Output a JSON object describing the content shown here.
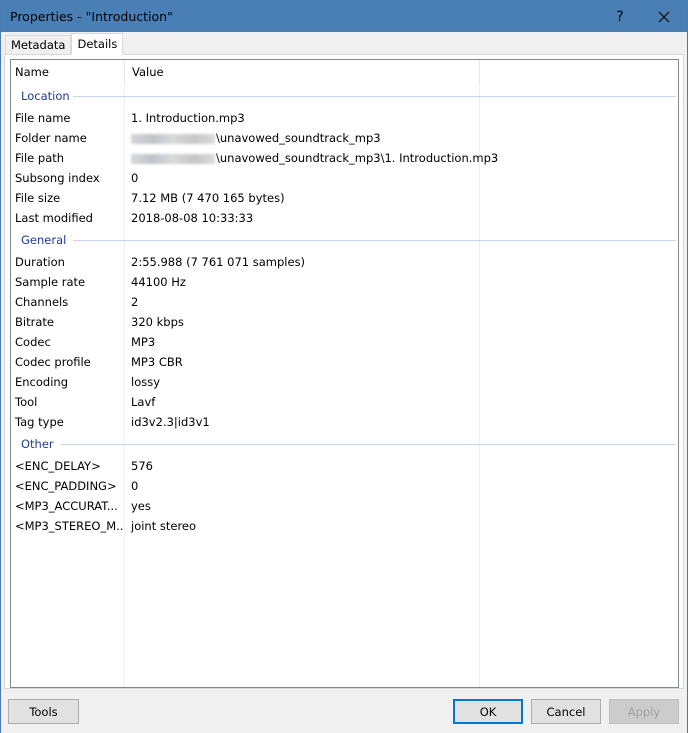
{
  "window": {
    "title": "Properties - \"Introduction\"",
    "help_label": "?"
  },
  "tabs": [
    {
      "label": "Metadata",
      "active": false
    },
    {
      "label": "Details",
      "active": true
    }
  ],
  "columns": {
    "name": "Name",
    "value": "Value"
  },
  "groups": {
    "location": {
      "label": "Location",
      "rows": [
        {
          "name": "File name",
          "value": "1. Introduction.mp3"
        },
        {
          "name": "Folder name",
          "value": "\\unavowed_soundtrack_mp3"
        },
        {
          "name": "File path",
          "value": "\\unavowed_soundtrack_mp3\\1. Introduction.mp3"
        },
        {
          "name": "Subsong index",
          "value": "0"
        },
        {
          "name": "File size",
          "value": "7.12 MB (7 470 165 bytes)"
        },
        {
          "name": "Last modified",
          "value": "2018-08-08 10:33:33"
        }
      ]
    },
    "general": {
      "label": "General",
      "rows": [
        {
          "name": "Duration",
          "value": "2:55.988 (7 761 071 samples)"
        },
        {
          "name": "Sample rate",
          "value": "44100 Hz"
        },
        {
          "name": "Channels",
          "value": "2"
        },
        {
          "name": "Bitrate",
          "value": "320 kbps"
        },
        {
          "name": "Codec",
          "value": "MP3"
        },
        {
          "name": "Codec profile",
          "value": "MP3 CBR"
        },
        {
          "name": "Encoding",
          "value": "lossy"
        },
        {
          "name": "Tool",
          "value": "Lavf"
        },
        {
          "name": "Tag type",
          "value": "id3v2.3|id3v1"
        }
      ]
    },
    "other": {
      "label": "Other",
      "rows": [
        {
          "name": "<ENC_DELAY>",
          "value": "576"
        },
        {
          "name": "<ENC_PADDING>",
          "value": "0"
        },
        {
          "name": "<MP3_ACCURAT...",
          "value": "yes"
        },
        {
          "name": "<MP3_STEREO_M...",
          "value": "joint stereo"
        }
      ]
    }
  },
  "buttons": {
    "tools": "Tools",
    "ok": "OK",
    "cancel": "Cancel",
    "apply": "Apply"
  },
  "colors": {
    "titlebar": "#4a7fb5",
    "group_label": "#1e3c96",
    "default_button_border": "#0078d7"
  }
}
